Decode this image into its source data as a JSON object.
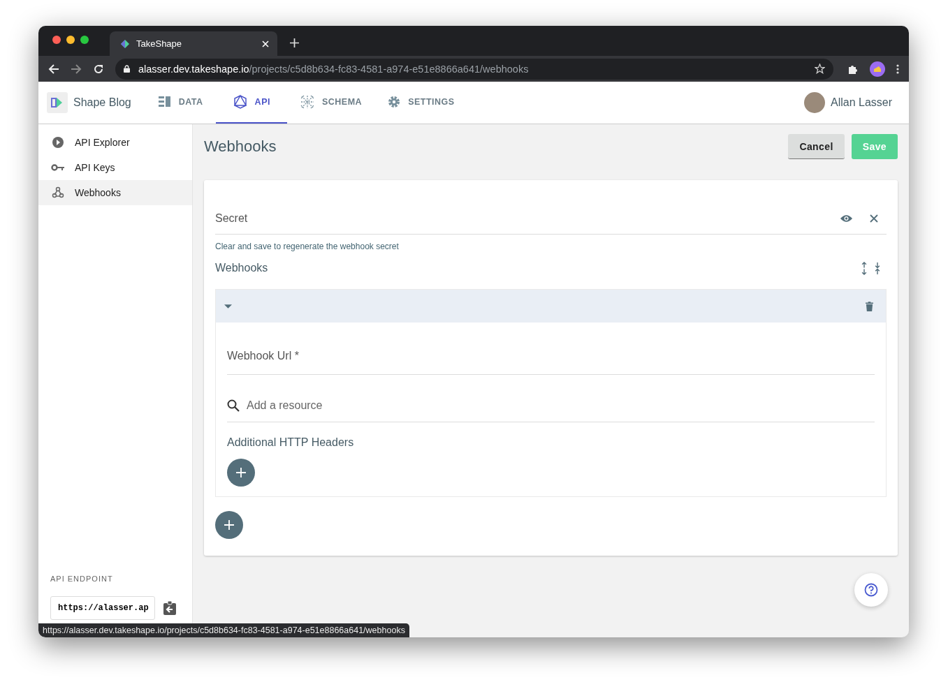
{
  "browser": {
    "tab_title": "TakeShape",
    "address_host": "alasser.dev.takeshape.io",
    "address_path": "/projects/c5d8b634-fc83-4581-a974-e51e8866a641/webhooks"
  },
  "header": {
    "project": "Shape Blog",
    "nav": [
      {
        "label": "DATA",
        "selected": false
      },
      {
        "label": "API",
        "selected": true
      },
      {
        "label": "SCHEMA",
        "selected": false
      },
      {
        "label": "SETTINGS",
        "selected": false
      }
    ],
    "user": "Allan Lasser"
  },
  "sidebar": {
    "items": [
      {
        "label": "API Explorer",
        "selected": false
      },
      {
        "label": "API Keys",
        "selected": false
      },
      {
        "label": "Webhooks",
        "selected": true
      }
    ],
    "endpoint_label": "API ENDPOINT",
    "endpoint_value": "https://alasser.ap"
  },
  "page": {
    "title": "Webhooks",
    "cancel": "Cancel",
    "save": "Save"
  },
  "form": {
    "secret_label": "Secret",
    "secret_hint": "Clear and save to regenerate the webhook secret",
    "webhooks_label": "Webhooks",
    "item": {
      "expanded": true,
      "url_label": "Webhook Url *",
      "resource_placeholder": "Add a resource",
      "headers_label": "Additional HTTP Headers"
    }
  },
  "status_url": "https://alasser.dev.takeshape.io/projects/c5d8b634-fc83-4581-a974-e51e8866a641/webhooks"
}
